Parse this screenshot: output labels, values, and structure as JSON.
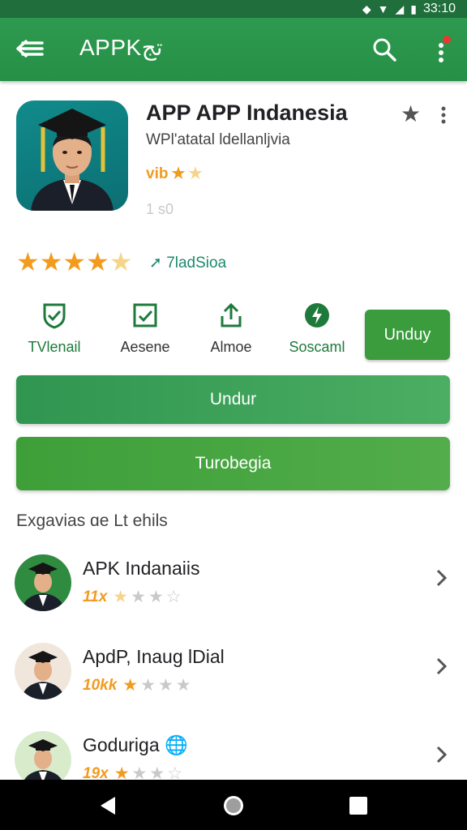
{
  "status_bar": {
    "time": "33:10",
    "icons": [
      "signal-icon",
      "wifi-icon",
      "cellular-icon",
      "battery-icon"
    ]
  },
  "app_bar": {
    "title": "APPKتج",
    "menu_icon": "back-menu-icon",
    "search_icon": "search-icon",
    "overflow_icon": "more-vert-icon",
    "notification_color": "#e53935"
  },
  "app": {
    "name": "APP APP Indanesia",
    "developer": "WPl'atatal ldellanljvia",
    "mini_rating_text": "vib",
    "size_text": "1 s0"
  },
  "rating": {
    "stars": 4.5,
    "caption": "7ladSioa",
    "caption_prefix_icon": "arrow-icon"
  },
  "actions": [
    {
      "label": "TVlenail",
      "icon": "shield-check-icon"
    },
    {
      "label": "Aesene",
      "icon": "checkbox-icon"
    },
    {
      "label": "Almoe",
      "icon": "share-upload-icon"
    },
    {
      "label": "Soscaml",
      "icon": "bolt-circle-icon"
    }
  ],
  "mini_install_label": "Unduy",
  "download_label": "Undur",
  "try_label": "Turobegia",
  "related": {
    "title": "Exgavias ɑe Lt ehils",
    "items": [
      {
        "name": "APK Indanaiis",
        "count": "11x",
        "rating": 1,
        "avatar_bg": "#2e8b3f"
      },
      {
        "name": "ApdP, Inaug lDial",
        "count": "10kk",
        "rating": 1,
        "avatar_bg": "#f1e6dc"
      },
      {
        "name": "Goduriga",
        "count": "19x",
        "rating": 1,
        "avatar_bg": "#d8eccc"
      }
    ]
  },
  "colors": {
    "primary": "#2e9a4f",
    "accent": "#f29b1d",
    "install": "#3a9c3d"
  }
}
